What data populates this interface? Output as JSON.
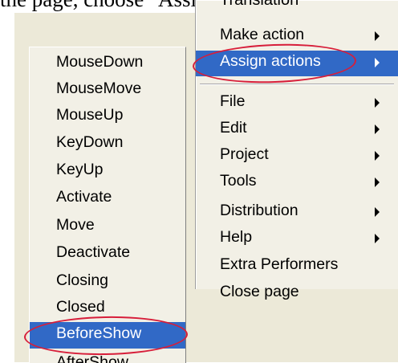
{
  "caption": "the page, choose \"Assign actions\", click",
  "main_menu": {
    "partial_item": "Translation",
    "items": [
      {
        "label": "Make action",
        "submenu": true,
        "selected": false
      },
      {
        "label": "Assign actions",
        "submenu": true,
        "selected": true
      },
      {
        "label": "File",
        "submenu": true,
        "selected": false
      },
      {
        "label": "Edit",
        "submenu": true,
        "selected": false
      },
      {
        "label": "Project",
        "submenu": true,
        "selected": false
      },
      {
        "label": "Tools",
        "submenu": true,
        "selected": false
      },
      {
        "label": "Distribution",
        "submenu": true,
        "selected": false
      },
      {
        "label": "Help",
        "submenu": true,
        "selected": false
      },
      {
        "label": "Extra Performers",
        "submenu": false,
        "selected": false
      },
      {
        "label": "Close page",
        "submenu": false,
        "selected": false
      }
    ]
  },
  "sub_menu": {
    "items": [
      {
        "label": "MouseDown",
        "selected": false
      },
      {
        "label": "MouseMove",
        "selected": false
      },
      {
        "label": "MouseUp",
        "selected": false
      },
      {
        "label": "KeyDown",
        "selected": false
      },
      {
        "label": "KeyUp",
        "selected": false
      },
      {
        "label": "Activate",
        "selected": false
      },
      {
        "label": "Move",
        "selected": false
      },
      {
        "label": "Deactivate",
        "selected": false
      },
      {
        "label": "Closing",
        "selected": false
      },
      {
        "label": "Closed",
        "selected": false
      },
      {
        "label": "BeforeShow",
        "selected": true
      },
      {
        "label": "AfterShow",
        "selected": false
      }
    ]
  },
  "colors": {
    "menu_background": "#f2f0e6",
    "highlight": "#3169c6",
    "annotation_oval": "#d71e3a"
  }
}
